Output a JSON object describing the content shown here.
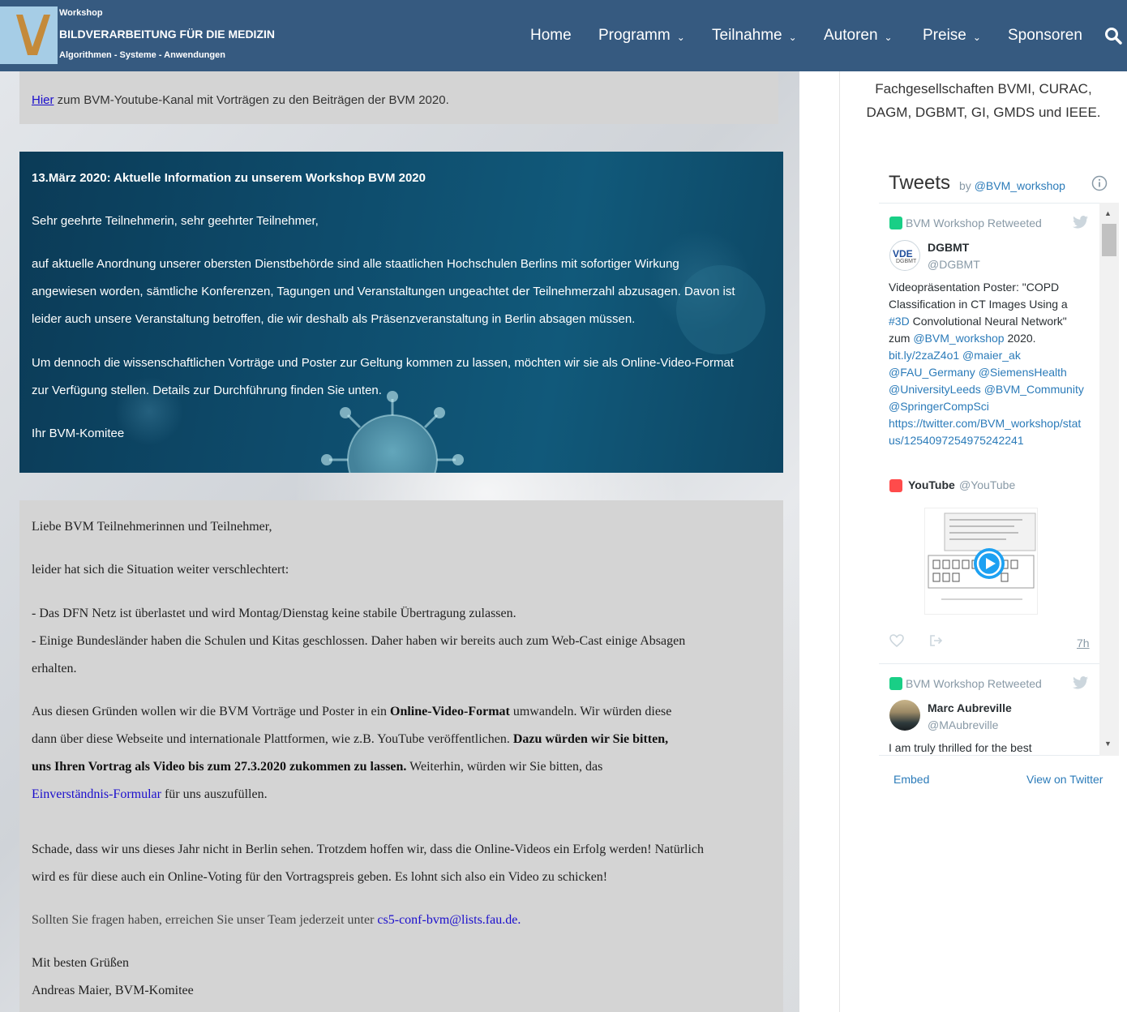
{
  "header": {
    "brand_small": "Workshop",
    "brand_title": "BILDVERARBEITUNG FÜR DIE MEDIZIN",
    "brand_sub": "Algorithmen - Systeme - Anwendungen",
    "nav": [
      {
        "label": "Home",
        "has_dropdown": false
      },
      {
        "label": "Programm",
        "has_dropdown": true
      },
      {
        "label": "Teilnahme",
        "has_dropdown": true
      },
      {
        "label": "Autoren",
        "has_dropdown": true
      },
      {
        "label": "Preise",
        "has_dropdown": true
      },
      {
        "label": "Sponsoren",
        "has_dropdown": false
      }
    ],
    "search_icon": "search-icon",
    "colors": {
      "bar": "#365a80",
      "text": "#ffffff"
    }
  },
  "youtube_notice": {
    "link": "Hier",
    "text": " zum BVM-Youtube-Kanal mit Vorträgen zu den Beiträgen der BVM 2020."
  },
  "announcement": {
    "heading": "13.März 2020: Aktuelle Information zu unserem Workshop BVM 2020",
    "salutation": "Sehr geehrte Teilnehmerin, sehr geehrter Teilnehmer,",
    "p1_lines": [
      "auf aktuelle Anordnung unserer obersten Dienstbehörde sind alle staatlichen Hochschulen Berlins mit sofortiger Wirkung",
      "angewiesen worden, sämtliche Konferenzen, Tagungen und Veranstaltungen ungeachtet der Teilnehmerzahl abzusagen. Davon ist",
      "leider auch unsere Veranstaltung betroffen, die wir deshalb als Präsenzveranstaltung in Berlin absagen müssen."
    ],
    "p2_lines": [
      "Um dennoch die wissenschaftlichen Vorträge und Poster zur Geltung kommen zu lassen, möchten wir sie als Online-Video-Format",
      "zur Verfügung stellen. Details zur Durchführung finden Sie unten."
    ],
    "signature": "Ihr BVM-Komitee",
    "colors": {
      "background": "#0e4c6c",
      "text": "#ffffff"
    }
  },
  "letter": {
    "greeting": "Liebe BVM Teilnehmerinnen und Teilnehmer,",
    "situation": "leider hat sich die Situation weiter verschlechtert:",
    "bullet1": "- Das DFN Netz ist überlastet und wird Montag/Dienstag keine stabile Übertragung zulassen.",
    "bullet2_line1": "- Einige Bundesländer haben die Schulen und Kitas geschlossen. Daher haben wir bereits auch zum Web-Cast einige Absagen",
    "bullet2_line2": "erhalten.",
    "p3_line1_a": "Aus diesen Gründen wollen wir die BVM Vorträge und Poster in ein ",
    "p3_line1_b": "Online-Video-Format",
    "p3_line1_c": " umwandeln. Wir würden diese",
    "p3_line2_a": "dann über diese Webseite und internationale Plattformen, wie z.B. YouTube veröffentlichen. ",
    "p3_line2_b": "Dazu würden wir Sie bitten,",
    "p3_line3_a": "uns Ihren Vortrag als Video bis zum 27.3.2020 zukommen zu lassen.",
    "p3_line3_b": " Weiterhin, würden wir Sie bitten, das",
    "p3_line4_link": "Einverständnis-Formular",
    "p3_line4_text": " für uns auszufüllen.",
    "p4_line1": "Schade, dass wir uns dieses Jahr nicht in Berlin sehen. Trotzdem hoffen wir, dass die Online-Videos ein Erfolg werden! Natürlich",
    "p4_line2": "wird es für diese auch ein Online-Voting für den Vortragspreis geben. Es lohnt sich also ein Video zu schicken!",
    "contact_text": "Sollten Sie fragen haben, erreichen Sie unser Team jederzeit unter ",
    "contact_email": "cs5-conf-bvm@lists.fau.de.",
    "closing": "Mit besten Grüßen",
    "sender": "Andreas Maier, BVM-Komitee"
  },
  "sidebar": {
    "societies_line1": "Fachgesellschaften BVMI, CURAC,",
    "societies_line2": "DAGM, DGBMT, GI, GMDS und IEEE.",
    "tweets": {
      "title": "Tweets",
      "by": "by ",
      "handle": "@BVM_workshop",
      "tweet1": {
        "context": "BVM Workshop Retweeted",
        "avatar_text": "VDE",
        "avatar_sub": "DGBMT",
        "name": "DGBMT",
        "handle": "@DGBMT",
        "line1": "Videopräsentation Poster: \"COPD",
        "line2": "Classification in CT Images Using a",
        "line3_tag": "#3D",
        "line3_rest": " Convolutional Neural Network\"",
        "line4_a": "zum ",
        "line4_link": "@BVM_workshop",
        "line4_b": " 2020.",
        "line5": "bit.ly/2zaZ4o1 @maier_ak",
        "line6": "@FAU_Germany @SiemensHealth",
        "line7": "@UniversityLeeds @BVM_Community",
        "line8": "@SpringerCompSci",
        "line9": "https://twitter.com/BVM_workshop/stat",
        "line10": "us/1254097254975242241",
        "embed_name": "YouTube",
        "embed_handle": "@YouTube",
        "time": "7h"
      },
      "tweet2": {
        "context": "BVM Workshop Retweeted",
        "name": "Marc Aubreville",
        "handle": "@MAubreville",
        "text": "I am truly thrilled for the best"
      },
      "embed_label": "Embed",
      "view_label": "View on Twitter"
    }
  }
}
